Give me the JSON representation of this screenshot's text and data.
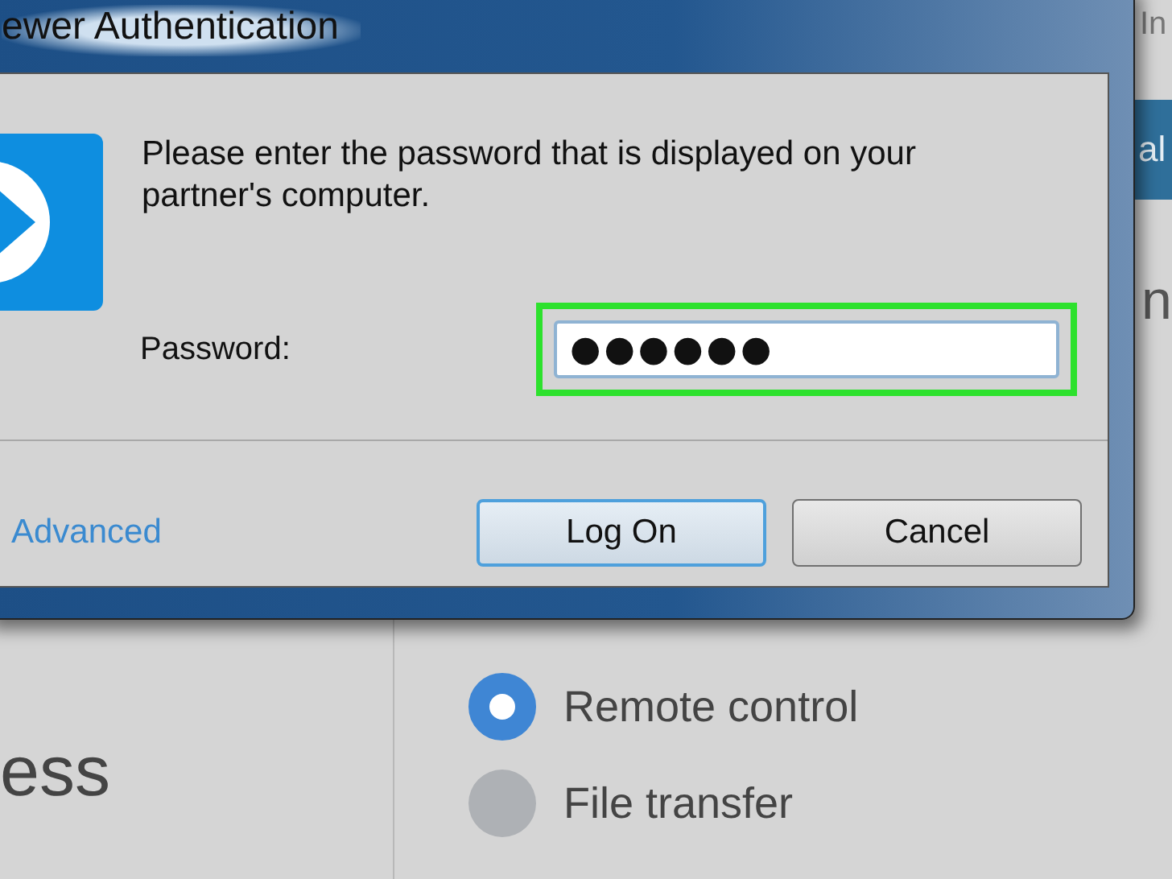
{
  "dialog": {
    "title": "ewer Authentication",
    "message": "Please enter the password that is displayed on your partner's computer.",
    "password_label": "Password:",
    "password_value": "●●●●●●",
    "password_highlighted": true,
    "advanced_link": "Advanced",
    "buttons": [
      {
        "label": "Log On",
        "default": true
      },
      {
        "label": "Cancel",
        "default": false
      }
    ]
  },
  "background": {
    "corner_text": "In",
    "tab_text": "al",
    "heading_text": "n",
    "left_text": "ess",
    "options": [
      {
        "label": "Remote control",
        "selected": true
      },
      {
        "label": "File transfer",
        "selected": false
      }
    ]
  }
}
